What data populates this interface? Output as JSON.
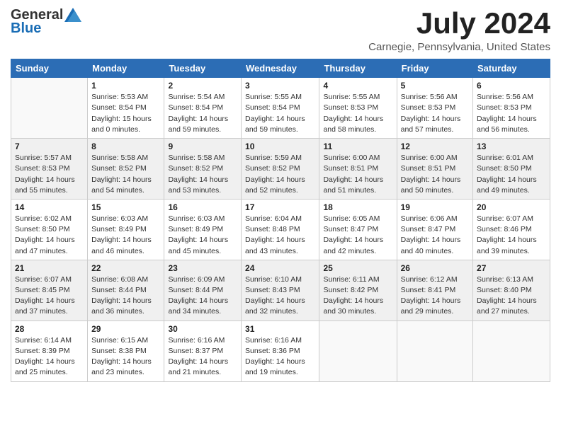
{
  "header": {
    "logo_general": "General",
    "logo_blue": "Blue",
    "month": "July 2024",
    "location": "Carnegie, Pennsylvania, United States"
  },
  "weekdays": [
    "Sunday",
    "Monday",
    "Tuesday",
    "Wednesday",
    "Thursday",
    "Friday",
    "Saturday"
  ],
  "weeks": [
    [
      {
        "day": "",
        "sunrise": "",
        "sunset": "",
        "daylight": "",
        "empty": true
      },
      {
        "day": "1",
        "sunrise": "Sunrise: 5:53 AM",
        "sunset": "Sunset: 8:54 PM",
        "daylight": "Daylight: 15 hours and 0 minutes."
      },
      {
        "day": "2",
        "sunrise": "Sunrise: 5:54 AM",
        "sunset": "Sunset: 8:54 PM",
        "daylight": "Daylight: 14 hours and 59 minutes."
      },
      {
        "day": "3",
        "sunrise": "Sunrise: 5:55 AM",
        "sunset": "Sunset: 8:54 PM",
        "daylight": "Daylight: 14 hours and 59 minutes."
      },
      {
        "day": "4",
        "sunrise": "Sunrise: 5:55 AM",
        "sunset": "Sunset: 8:53 PM",
        "daylight": "Daylight: 14 hours and 58 minutes."
      },
      {
        "day": "5",
        "sunrise": "Sunrise: 5:56 AM",
        "sunset": "Sunset: 8:53 PM",
        "daylight": "Daylight: 14 hours and 57 minutes."
      },
      {
        "day": "6",
        "sunrise": "Sunrise: 5:56 AM",
        "sunset": "Sunset: 8:53 PM",
        "daylight": "Daylight: 14 hours and 56 minutes."
      }
    ],
    [
      {
        "day": "7",
        "sunrise": "Sunrise: 5:57 AM",
        "sunset": "Sunset: 8:53 PM",
        "daylight": "Daylight: 14 hours and 55 minutes."
      },
      {
        "day": "8",
        "sunrise": "Sunrise: 5:58 AM",
        "sunset": "Sunset: 8:52 PM",
        "daylight": "Daylight: 14 hours and 54 minutes."
      },
      {
        "day": "9",
        "sunrise": "Sunrise: 5:58 AM",
        "sunset": "Sunset: 8:52 PM",
        "daylight": "Daylight: 14 hours and 53 minutes."
      },
      {
        "day": "10",
        "sunrise": "Sunrise: 5:59 AM",
        "sunset": "Sunset: 8:52 PM",
        "daylight": "Daylight: 14 hours and 52 minutes."
      },
      {
        "day": "11",
        "sunrise": "Sunrise: 6:00 AM",
        "sunset": "Sunset: 8:51 PM",
        "daylight": "Daylight: 14 hours and 51 minutes."
      },
      {
        "day": "12",
        "sunrise": "Sunrise: 6:00 AM",
        "sunset": "Sunset: 8:51 PM",
        "daylight": "Daylight: 14 hours and 50 minutes."
      },
      {
        "day": "13",
        "sunrise": "Sunrise: 6:01 AM",
        "sunset": "Sunset: 8:50 PM",
        "daylight": "Daylight: 14 hours and 49 minutes."
      }
    ],
    [
      {
        "day": "14",
        "sunrise": "Sunrise: 6:02 AM",
        "sunset": "Sunset: 8:50 PM",
        "daylight": "Daylight: 14 hours and 47 minutes."
      },
      {
        "day": "15",
        "sunrise": "Sunrise: 6:03 AM",
        "sunset": "Sunset: 8:49 PM",
        "daylight": "Daylight: 14 hours and 46 minutes."
      },
      {
        "day": "16",
        "sunrise": "Sunrise: 6:03 AM",
        "sunset": "Sunset: 8:49 PM",
        "daylight": "Daylight: 14 hours and 45 minutes."
      },
      {
        "day": "17",
        "sunrise": "Sunrise: 6:04 AM",
        "sunset": "Sunset: 8:48 PM",
        "daylight": "Daylight: 14 hours and 43 minutes."
      },
      {
        "day": "18",
        "sunrise": "Sunrise: 6:05 AM",
        "sunset": "Sunset: 8:47 PM",
        "daylight": "Daylight: 14 hours and 42 minutes."
      },
      {
        "day": "19",
        "sunrise": "Sunrise: 6:06 AM",
        "sunset": "Sunset: 8:47 PM",
        "daylight": "Daylight: 14 hours and 40 minutes."
      },
      {
        "day": "20",
        "sunrise": "Sunrise: 6:07 AM",
        "sunset": "Sunset: 8:46 PM",
        "daylight": "Daylight: 14 hours and 39 minutes."
      }
    ],
    [
      {
        "day": "21",
        "sunrise": "Sunrise: 6:07 AM",
        "sunset": "Sunset: 8:45 PM",
        "daylight": "Daylight: 14 hours and 37 minutes."
      },
      {
        "day": "22",
        "sunrise": "Sunrise: 6:08 AM",
        "sunset": "Sunset: 8:44 PM",
        "daylight": "Daylight: 14 hours and 36 minutes."
      },
      {
        "day": "23",
        "sunrise": "Sunrise: 6:09 AM",
        "sunset": "Sunset: 8:44 PM",
        "daylight": "Daylight: 14 hours and 34 minutes."
      },
      {
        "day": "24",
        "sunrise": "Sunrise: 6:10 AM",
        "sunset": "Sunset: 8:43 PM",
        "daylight": "Daylight: 14 hours and 32 minutes."
      },
      {
        "day": "25",
        "sunrise": "Sunrise: 6:11 AM",
        "sunset": "Sunset: 8:42 PM",
        "daylight": "Daylight: 14 hours and 30 minutes."
      },
      {
        "day": "26",
        "sunrise": "Sunrise: 6:12 AM",
        "sunset": "Sunset: 8:41 PM",
        "daylight": "Daylight: 14 hours and 29 minutes."
      },
      {
        "day": "27",
        "sunrise": "Sunrise: 6:13 AM",
        "sunset": "Sunset: 8:40 PM",
        "daylight": "Daylight: 14 hours and 27 minutes."
      }
    ],
    [
      {
        "day": "28",
        "sunrise": "Sunrise: 6:14 AM",
        "sunset": "Sunset: 8:39 PM",
        "daylight": "Daylight: 14 hours and 25 minutes."
      },
      {
        "day": "29",
        "sunrise": "Sunrise: 6:15 AM",
        "sunset": "Sunset: 8:38 PM",
        "daylight": "Daylight: 14 hours and 23 minutes."
      },
      {
        "day": "30",
        "sunrise": "Sunrise: 6:16 AM",
        "sunset": "Sunset: 8:37 PM",
        "daylight": "Daylight: 14 hours and 21 minutes."
      },
      {
        "day": "31",
        "sunrise": "Sunrise: 6:16 AM",
        "sunset": "Sunset: 8:36 PM",
        "daylight": "Daylight: 14 hours and 19 minutes."
      },
      {
        "day": "",
        "sunrise": "",
        "sunset": "",
        "daylight": "",
        "empty": true
      },
      {
        "day": "",
        "sunrise": "",
        "sunset": "",
        "daylight": "",
        "empty": true
      },
      {
        "day": "",
        "sunrise": "",
        "sunset": "",
        "daylight": "",
        "empty": true
      }
    ]
  ]
}
